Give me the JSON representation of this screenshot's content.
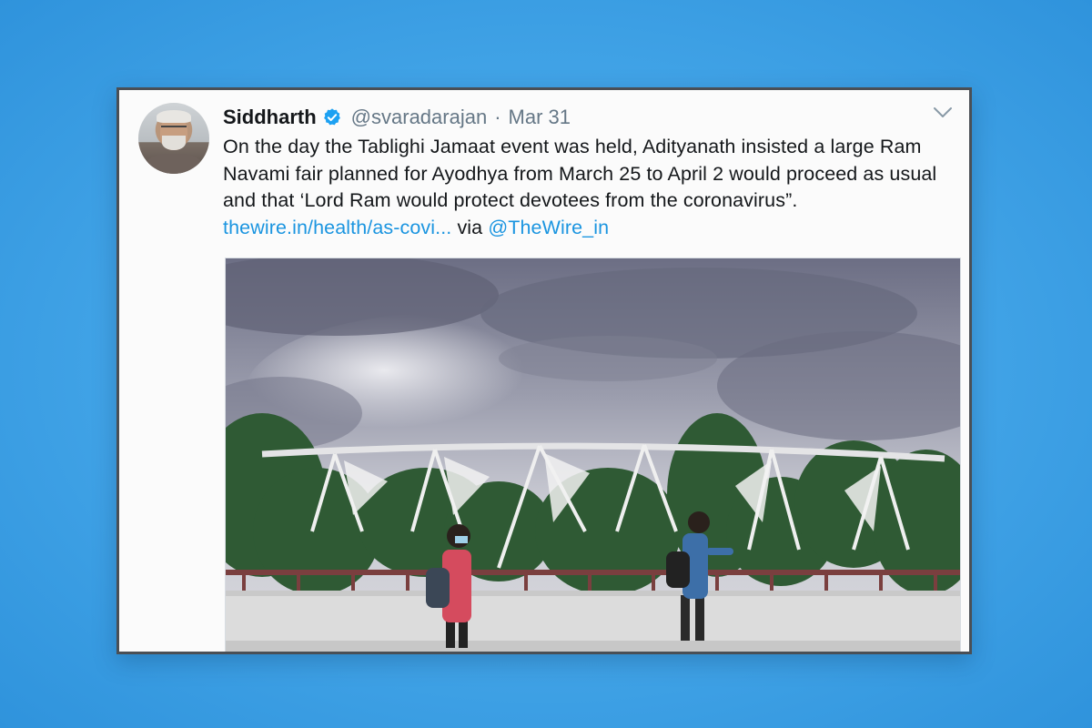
{
  "tweet": {
    "author_name": "Siddharth",
    "handle": "@svaradarajan",
    "separator": "·",
    "date": "Mar 31",
    "text_main": "On the day the Tablighi Jamaat event was held, Adityanath insisted a large Ram Navami fair planned for Ayodhya from March 25 to April 2 would proceed as usual and that ‘Lord Ram would protect devotees from the coronavirus”.",
    "link_text": "thewire.in/health/as-covi...",
    "via_text": "via",
    "mention": "@TheWire_in"
  },
  "icons": {
    "verified": "verified-badge-icon",
    "menu": "chevron-down-icon"
  },
  "colors": {
    "background": "#45a7e9",
    "card": "#fbfbfb",
    "link": "#1b95e0",
    "verified": "#1da1f2"
  }
}
